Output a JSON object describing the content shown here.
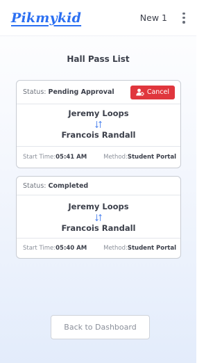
{
  "header": {
    "logo": "Pikmykid",
    "user_name": "New 1"
  },
  "page": {
    "title": "Hall Pass List"
  },
  "passes": [
    {
      "status_label": "Status:",
      "status_value": "Pending Approval",
      "cancel_label": "Cancel",
      "student": "Jeremy Loops",
      "teacher": "Francois Randall",
      "start_label": "Start Time:",
      "start_time": "05:41 AM",
      "method_label": "Method:",
      "method": "Student Portal"
    },
    {
      "status_label": "Status:",
      "status_value": "Completed",
      "student": "Jeremy Loops",
      "teacher": "Francois Randall",
      "start_label": "Start Time:",
      "start_time": "05:40 AM",
      "method_label": "Method:",
      "method": "Student Portal"
    }
  ],
  "footer": {
    "back_label": "Back to Dashboard"
  },
  "colors": {
    "brand": "#2b6ff2",
    "cancel": "#e0363d",
    "swap_icon": "#5b8df0"
  },
  "icons": {
    "kebab": "kebab-menu-icon",
    "cancel": "user-cancel-icon",
    "swap": "swap-arrows-icon"
  }
}
